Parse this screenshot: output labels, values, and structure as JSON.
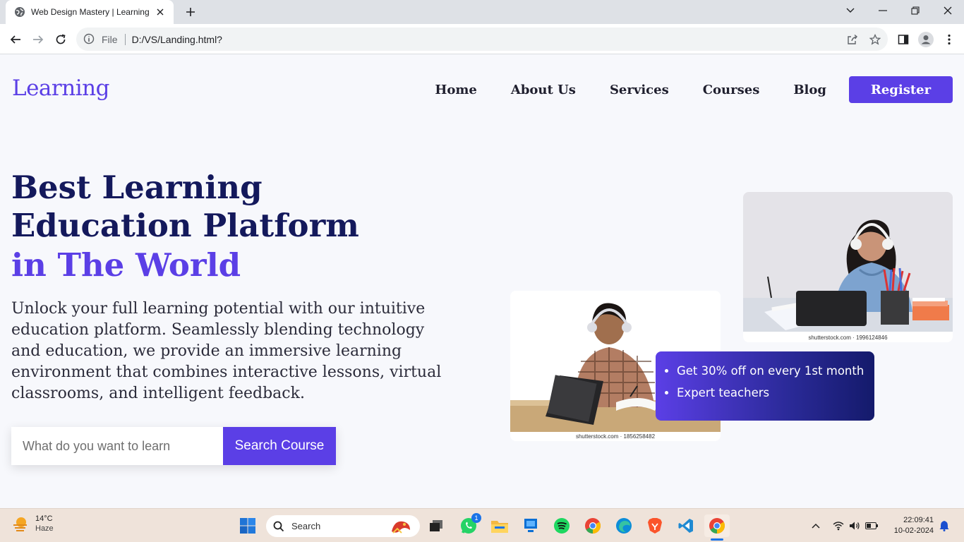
{
  "browser": {
    "tab_title": "Web Design Mastery | Learning Platform",
    "address_scheme": "File",
    "address_url": "D:/VS/Landing.html?"
  },
  "site": {
    "logo": "Learning",
    "nav": [
      "Home",
      "About Us",
      "Services",
      "Courses",
      "Blog"
    ],
    "register_label": "Register"
  },
  "hero": {
    "line1": "Best Learning",
    "line2": "Education Platform",
    "line3": "in The World",
    "description": "Unlock your full learning potential with our intuitive education platform. Seamlessly blending technology and education, we provide an immersive learning environment that combines interactive lessons, virtual classrooms, and intelligent feedback.",
    "search_placeholder": "What do you want to learn",
    "search_button": "Search Course"
  },
  "images": {
    "girl_caption": "shutterstock.com · 1996124846",
    "boy_caption": "shutterstock.com · 1856258482"
  },
  "offers": [
    "Get 30% off on every 1st month",
    "Expert teachers"
  ],
  "colors": {
    "accent": "#5b3fe6",
    "navy": "#14195c"
  },
  "taskbar": {
    "weather_temp": "14°C",
    "weather_cond": "Haze",
    "search_label": "Search",
    "whatsapp_badge": "1",
    "time": "22:09:41",
    "date": "10-02-2024"
  }
}
